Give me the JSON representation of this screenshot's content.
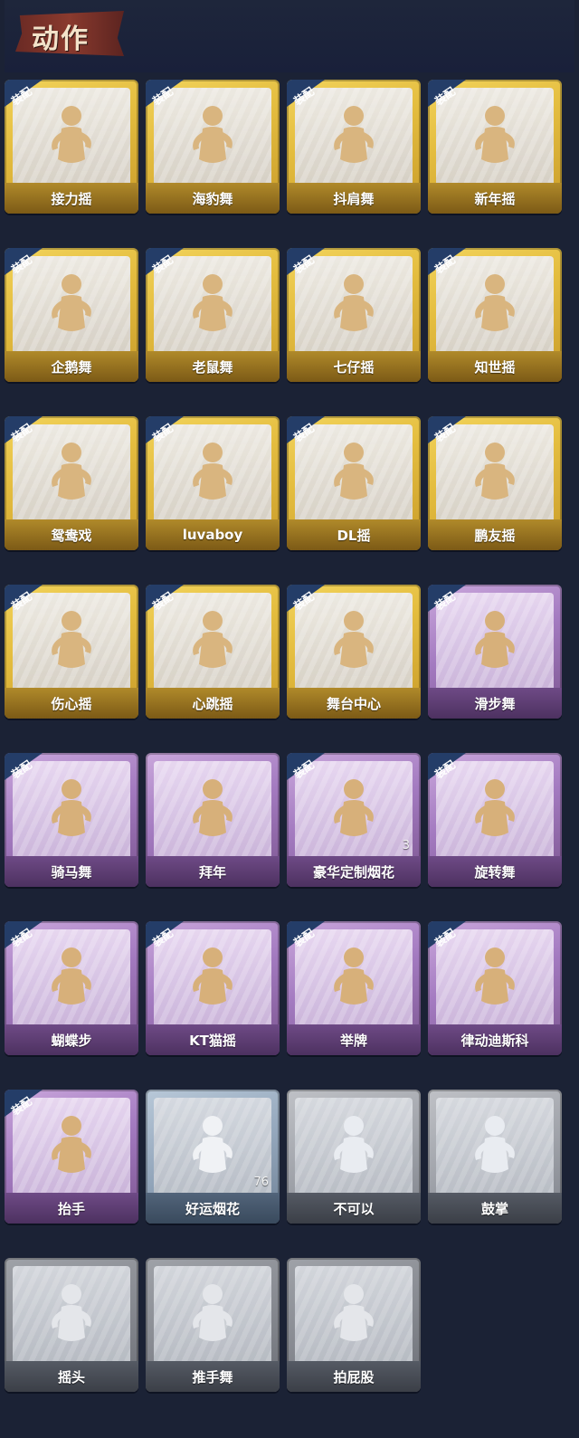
{
  "header": {
    "title": "动作"
  },
  "badge_text": "装配",
  "colors": {
    "background": "#1b2235",
    "gold": "#e4bd3f",
    "purple": "#a37ac0",
    "blue": "#93a6bb",
    "gray": "#a0a3aa",
    "badge": "#243d68"
  },
  "actions": [
    {
      "name": "接力摇",
      "tier": "gold",
      "equipped": true
    },
    {
      "name": "海豹舞",
      "tier": "gold",
      "equipped": true
    },
    {
      "name": "抖肩舞",
      "tier": "gold",
      "equipped": true
    },
    {
      "name": "新年摇",
      "tier": "gold",
      "equipped": true
    },
    {
      "name": "企鹅舞",
      "tier": "gold",
      "equipped": true
    },
    {
      "name": "老鼠舞",
      "tier": "gold",
      "equipped": true
    },
    {
      "name": "七仔摇",
      "tier": "gold",
      "equipped": true
    },
    {
      "name": "知世摇",
      "tier": "gold",
      "equipped": true
    },
    {
      "name": "鸳鸯戏",
      "tier": "gold",
      "equipped": true
    },
    {
      "name": "luvaboy",
      "tier": "gold",
      "equipped": true
    },
    {
      "name": "DL摇",
      "tier": "gold",
      "equipped": true
    },
    {
      "name": "鹏友摇",
      "tier": "gold",
      "equipped": true
    },
    {
      "name": "伤心摇",
      "tier": "gold",
      "equipped": true
    },
    {
      "name": "心跳摇",
      "tier": "gold",
      "equipped": true
    },
    {
      "name": "舞台中心",
      "tier": "gold",
      "equipped": true
    },
    {
      "name": "滑步舞",
      "tier": "purple",
      "equipped": true
    },
    {
      "name": "骑马舞",
      "tier": "purple",
      "equipped": true
    },
    {
      "name": "拜年",
      "tier": "purple",
      "equipped": false
    },
    {
      "name": "豪华定制烟花",
      "tier": "purple",
      "equipped": true,
      "qty": "3"
    },
    {
      "name": "旋转舞",
      "tier": "purple",
      "equipped": true
    },
    {
      "name": "蝴蝶步",
      "tier": "purple",
      "equipped": true
    },
    {
      "name": "KT猫摇",
      "tier": "purple",
      "equipped": true
    },
    {
      "name": "举牌",
      "tier": "purple",
      "equipped": true
    },
    {
      "name": "律动迪斯科",
      "tier": "purple",
      "equipped": true
    },
    {
      "name": "抬手",
      "tier": "purple",
      "equipped": true
    },
    {
      "name": "好运烟花",
      "tier": "blue",
      "equipped": false,
      "qty": "76"
    },
    {
      "name": "不可以",
      "tier": "gray",
      "equipped": false
    },
    {
      "name": "鼓掌",
      "tier": "gray",
      "equipped": false
    },
    {
      "name": "摇头",
      "tier": "gray-dim",
      "equipped": false
    },
    {
      "name": "推手舞",
      "tier": "gray-dim",
      "equipped": false
    },
    {
      "name": "拍屁股",
      "tier": "gray-dim",
      "equipped": false
    }
  ]
}
